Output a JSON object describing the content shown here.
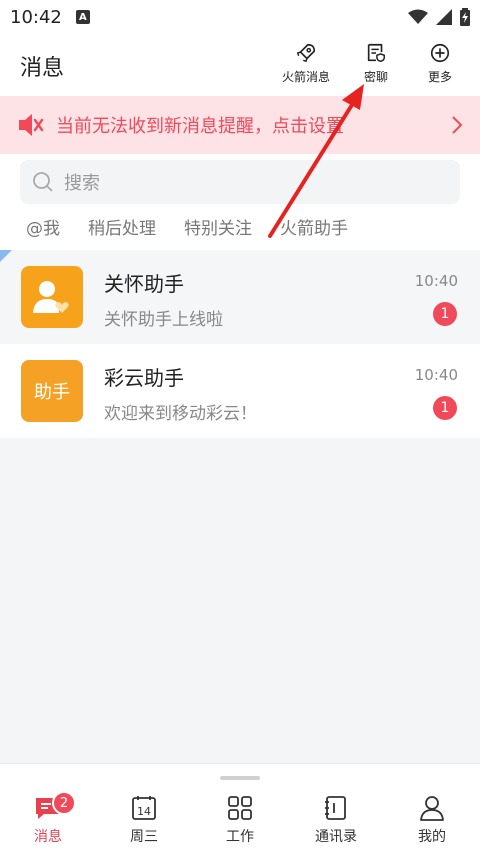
{
  "status": {
    "time": "10:42",
    "a_badge": "A"
  },
  "header": {
    "title": "消息",
    "actions": [
      {
        "label": "火箭消息",
        "icon": "rocket-icon"
      },
      {
        "label": "密聊",
        "icon": "secret-chat-icon"
      },
      {
        "label": "更多",
        "icon": "plus-circle-icon"
      }
    ]
  },
  "notice": {
    "text": "当前无法收到新消息提醒，点击设置",
    "icon": "speaker-muted-icon"
  },
  "search": {
    "placeholder": "搜索"
  },
  "filters": [
    "@我",
    "稍后处理",
    "特别关注",
    "火箭助手"
  ],
  "conversations": [
    {
      "name": "关怀助手",
      "preview": "关怀助手上线啦",
      "time": "10:40",
      "unread": "1",
      "avatar_color": "#f7a21b"
    },
    {
      "name": "彩云助手",
      "preview": "欢迎来到移动彩云！",
      "time": "10:40",
      "unread": "1",
      "avatar_color": "#f5a125",
      "avatar_text": "助手"
    }
  ],
  "bottom_nav": [
    {
      "label": "消息",
      "badge": "2",
      "active": true
    },
    {
      "label": "周三",
      "calendar_day": "14"
    },
    {
      "label": "工作"
    },
    {
      "label": "通讯录"
    },
    {
      "label": "我的"
    }
  ],
  "colors": {
    "accent": "#f04a5a",
    "notice_bg": "#fde3e5",
    "annotation_arrow": "#e52421"
  }
}
